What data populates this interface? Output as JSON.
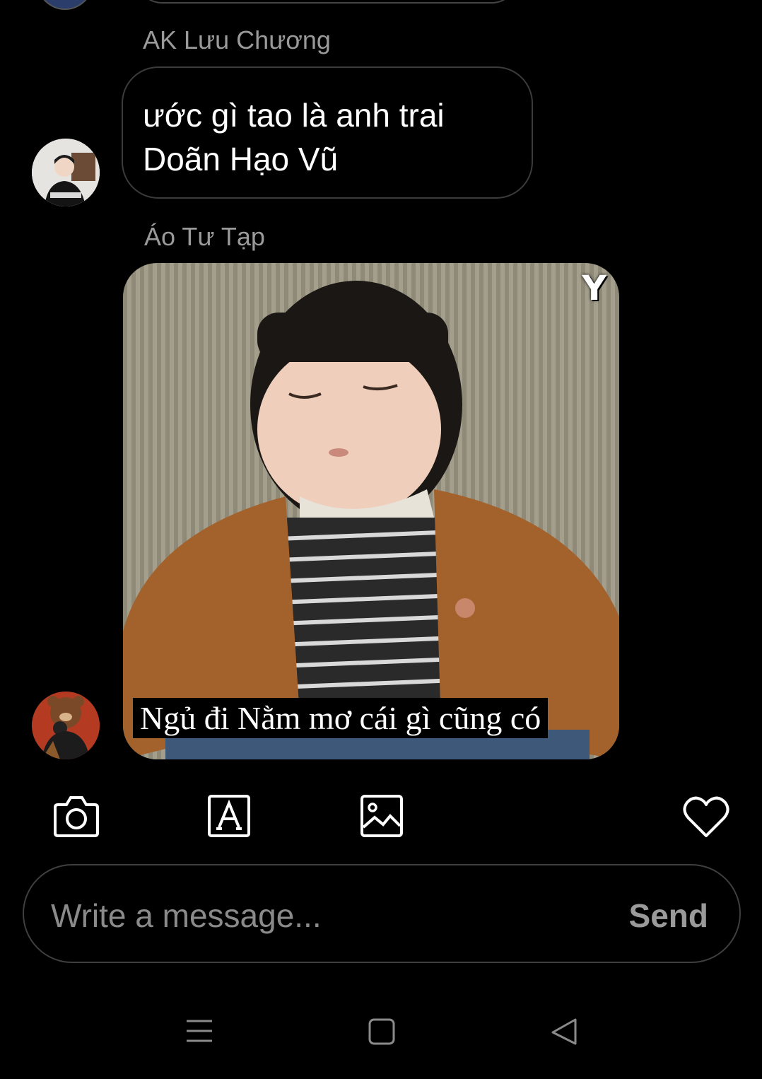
{
  "messages": [
    {
      "sender": "AK Lưu Chương",
      "text": "ước gì tao là anh trai Doãn Hạo Vũ",
      "type": "text"
    },
    {
      "sender": "Áo Tư Tạp",
      "type": "image",
      "image_caption": "Ngủ đi Nằm mơ cái gì cũng có",
      "image_corner_mark": "Y"
    }
  ],
  "toolbar": {
    "icons": [
      "camera-icon",
      "text-style-icon",
      "gallery-icon",
      "heart-icon"
    ]
  },
  "composer": {
    "placeholder": "Write a message...",
    "send_label": "Send"
  },
  "navbar": {
    "icons": [
      "menu-icon",
      "home-icon",
      "back-icon"
    ]
  },
  "colors": {
    "background": "#000000",
    "sender_name": "#9a9a9a",
    "bubble_border": "#3b3b3b",
    "icon": "#ffffff"
  }
}
